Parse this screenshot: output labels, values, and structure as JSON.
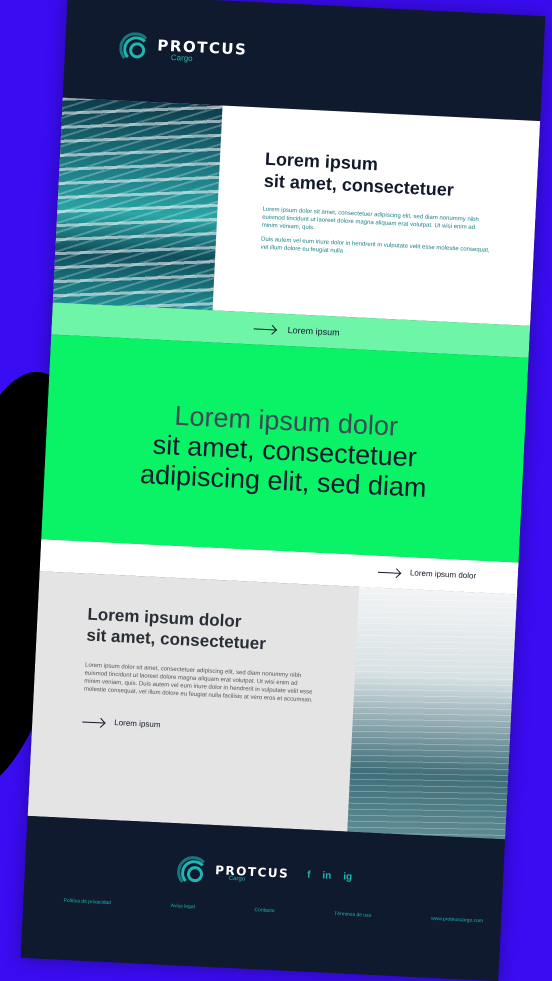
{
  "brand": {
    "name": "PROTCUS",
    "sub": "Cargo"
  },
  "hero": {
    "title_line1": "Lorem ipsum",
    "title_line2": "sit amet, consectetuer",
    "p1": "Lorem ipsum dolor sit amet, consectetuer adipiscing elit, sed diam nonummy nibh euismod tincidunt ut laoreet dolore magna aliquam erat volutpat. Ut wisi enim ad minim veniam, quis.",
    "p2": "Duis autem vel eum iriure dolor in hendrerit in vulputate velit esse molestie consequat, vel illum dolore eu feugiat nulla",
    "cta": "Lorem ipsum"
  },
  "banner": {
    "line1": "Lorem ipsum dolor",
    "line2": "sit amet, consectetuer",
    "line3": "adipiscing elit, sed diam",
    "cta": "Lorem ipsum dolor"
  },
  "section2": {
    "title_line1": "Lorem ipsum dolor",
    "title_line2": "sit amet, consectetuer",
    "p": "Lorem ipsum dolor sit amet, consectetuer adipiscing elit, sed diam nonummy nibh euismod tincidunt ut laoreet dolore magna aliquam erat volutpat. Ut wisi enim ad minim veniam, quis. Duis autem vel eum iriure dolor in hendrerit in vulputate velit esse molestie consequat, vel illum dolore eu feugiat nulla facilisis at vero eros et accumsan.",
    "cta": "Lorem ipsum"
  },
  "footer": {
    "social": [
      "f",
      "in",
      "ig"
    ],
    "links": [
      "Política de privacidad",
      "Aviso legal",
      "Contacto",
      "Términos de uso",
      "www.proteuscargo.com"
    ]
  },
  "colors": {
    "accent": "#0af266",
    "teal": "#1fb5b0",
    "navy": "#0f1a2e",
    "background": "#3a0cf2"
  }
}
